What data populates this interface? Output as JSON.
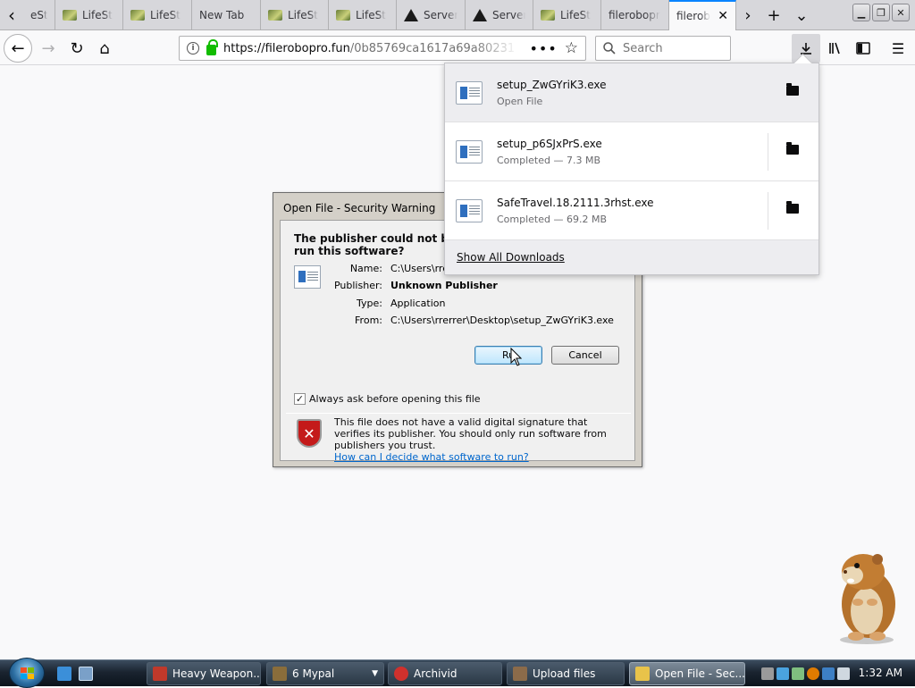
{
  "browser": {
    "tabs": [
      {
        "title": "eSty",
        "icon": "image-favicon-icon"
      },
      {
        "title": "LifeSt",
        "icon": "image-favicon-icon"
      },
      {
        "title": "LifeSt",
        "icon": "image-favicon-icon"
      },
      {
        "title": "New Tab",
        "icon": "none"
      },
      {
        "title": "LifeSt",
        "icon": "image-favicon-icon"
      },
      {
        "title": "LifeSt",
        "icon": "image-favicon-icon"
      },
      {
        "title": "Server",
        "icon": "warning-icon"
      },
      {
        "title": "Server",
        "icon": "warning-icon"
      },
      {
        "title": "LifeSt",
        "icon": "image-favicon-icon"
      },
      {
        "title": "filerobopr",
        "icon": "none"
      },
      {
        "title": "filerob",
        "icon": "none",
        "active": true
      }
    ],
    "url_host": "https://filerobopro.fun",
    "url_path": "/0b85769ca1617a69a80231",
    "search_placeholder": "Search",
    "accent": "#0a84ff"
  },
  "downloads": {
    "items": [
      {
        "name": "setup_ZwGYriK3.exe",
        "status": "Open File"
      },
      {
        "name": "setup_p6SJxPrS.exe",
        "status": "Completed — 7.3 MB"
      },
      {
        "name": "SafeTravel.18.2111.3rhst.exe",
        "status": "Completed — 69.2 MB"
      }
    ],
    "show_all": "Show All Downloads"
  },
  "dialog": {
    "title": "Open File - Security Warning",
    "heading_line1": "The publisher could not be ve",
    "heading_line2": "run this software?",
    "fields": [
      {
        "label": "Name:",
        "value": "C:\\Users\\rrerr"
      },
      {
        "label": "Publisher:",
        "value": "Unknown Publisher"
      },
      {
        "label": "Type:",
        "value": "Application"
      },
      {
        "label": "From:",
        "value": "C:\\Users\\rrerrer\\Desktop\\setup_ZwGYriK3.exe"
      }
    ],
    "run_label": "Ru",
    "cancel_label": "Cancel",
    "always_ask": "Always ask before opening this file",
    "always_ask_checked": true,
    "warning_text": "This file does not have a valid digital signature that verifies its publisher.  You should only run software from publishers you trust.",
    "help_link": "How can I decide what software to run?"
  },
  "taskbar": {
    "buttons": [
      {
        "label": "Heavy Weapon...",
        "icon_color": "#c0392b"
      },
      {
        "label": "6  Mypal",
        "icon_color": "#8a6d3b",
        "group": true
      },
      {
        "label": "Archivid",
        "icon_color": "#d0312d"
      },
      {
        "label": "Upload files",
        "icon_color": "#8b6b4a"
      },
      {
        "label": "Open File - Sec...",
        "icon_color": "#e8c34a",
        "active": true
      }
    ],
    "clock": "1:32 AM"
  }
}
